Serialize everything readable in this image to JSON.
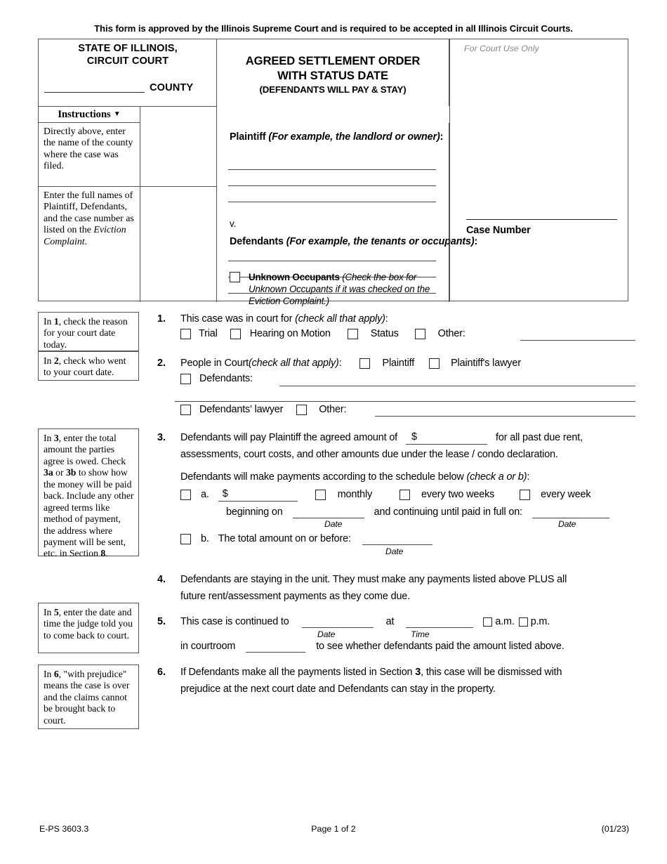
{
  "approval_notice": "This form is approved by the Illinois Supreme Court and is required to be accepted in all Illinois Circuit Courts.",
  "caption": {
    "state_line1": "STATE OF ILLINOIS,",
    "state_line2": "CIRCUIT COURT",
    "county_word": "COUNTY",
    "title_line1": "AGREED SETTLEMENT ORDER",
    "title_line2": "WITH STATUS DATE",
    "title_sub": "(DEFENDANTS WILL PAY & STAY)",
    "court_use_only": "For Court Use Only",
    "case_number_label": "Case Number",
    "instructions_header": "Instructions",
    "instructions_caret": "▼",
    "instruction_1": "Directly above, enter the name of the county where the case was filed.",
    "instruction_2_part1": "Enter the full names of Plaintiff, Defendants, and the case number as listed on the ",
    "instruction_2_italic": "Eviction Complaint",
    "instruction_2_part3": ".",
    "plaintiff_label": "Plaintiff",
    "plaintiff_example": " (For example, the landlord or owner)",
    "plaintiff_colon": ":",
    "versus": "v.",
    "defendants_label": "Defendants",
    "defendants_example": " (For example, the tenants or occupants)",
    "defendants_colon": ":",
    "unknown_occupants_label": "Unknown Occupants",
    "unknown_occupants_note": " (Check the box for Unknown Occupants if it was checked on the Eviction Complaint.)"
  },
  "side_notes": {
    "note_1_pre": "In ",
    "note_1_num": "1",
    "note_1_post": ", check the reason for your court date today.",
    "note_2_pre": "In ",
    "note_2_num": "2",
    "note_2_post": ", check who went to your court date.",
    "note_3_a": "In ",
    "note_3_b": "3",
    "note_3_c": ", enter the total amount the parties agree is owed. Check ",
    "note_3_d": "3a",
    "note_3_e": " or ",
    "note_3_f": "3b",
    "note_3_g": " to show how the money will be paid back. Include any other agreed terms like method of payment, the address where payment will be sent, etc. in Section ",
    "note_3_h": "8",
    "note_3_i": ".",
    "note_5_pre": "In ",
    "note_5_num": "5",
    "note_5_post": ", enter the date and time the judge told you to come back to court.",
    "note_6_pre": "In ",
    "note_6_num": "6",
    "note_6_post": ", \"with prejudice\" means the case is over and the claims cannot be brought back to court."
  },
  "sections": {
    "s1": {
      "number": "1.",
      "text": "This case was in court for ",
      "hint": "(check all that apply)",
      "colon": ":",
      "opt_trial": "Trial",
      "opt_hearing": "Hearing on Motion",
      "opt_status": "Status",
      "opt_other": "Other:"
    },
    "s2": {
      "number": "2.",
      "text": "People in Court ",
      "hint": "(check all that apply)",
      "colon": ":",
      "opt_plaintiff": "Plaintiff",
      "opt_plaintiff_lawyer": "Plaintiff's lawyer",
      "opt_defendants": "Defendants:",
      "opt_defendants_lawyer": "Defendants' lawyer",
      "opt_other": "Other:"
    },
    "s3": {
      "number": "3.",
      "line1_a": "Defendants will pay Plaintiff the agreed amount of",
      "dollar": "$",
      "line1_b": "for all past due rent,",
      "line2": "assessments, court costs, and other amounts due under the lease / condo declaration.",
      "line3": "Defendants will make payments according to the schedule below ",
      "line3_hint": "(check a or b)",
      "line3_colon": ":",
      "a_label": "a.",
      "a_dollar": "$",
      "opt_monthly": "monthly",
      "opt_biweekly": "every two weeks",
      "opt_weekly": "every week",
      "beginning_on": "beginning on",
      "continuing": "and continuing until paid in full on:",
      "date_caption": "Date",
      "b_label": "b.",
      "b_text": "The total amount on or before:"
    },
    "s4": {
      "number": "4.",
      "line1": "Defendants are staying in the unit. They must make any payments listed above PLUS all",
      "line2": "future rent/assessment payments as they come due."
    },
    "s5": {
      "number": "5.",
      "line1_a": "This case is continued to",
      "at": "at",
      "am": "a.m.",
      "pm": "p.m.",
      "date_caption": "Date",
      "time_caption": "Time",
      "line2_a": "in courtroom",
      "line2_b": "to see whether defendants paid the amount listed above."
    },
    "s6": {
      "number": "6.",
      "line1_a": "If Defendants make all the payments listed in Section ",
      "line1_bold": "3",
      "line1_b": ", this case will be dismissed with",
      "line2": "prejudice at the next court date and Defendants can stay in the property."
    }
  },
  "footer": {
    "form_id": "E-PS 3603.3",
    "page": "Page 1 of 2",
    "revision": "(01/23)"
  }
}
